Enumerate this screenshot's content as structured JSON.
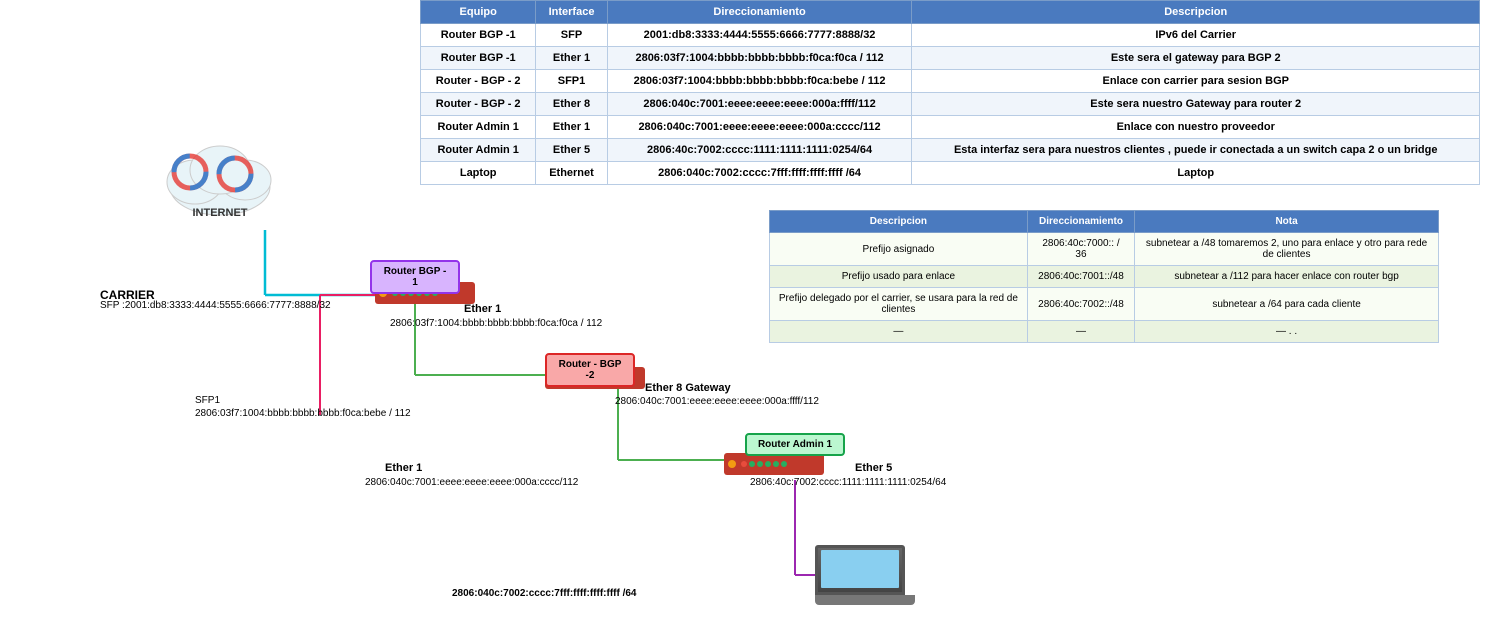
{
  "table1": {
    "headers": [
      "Equipo",
      "Interface",
      "Direccionamiento",
      "Descripcion"
    ],
    "rows": [
      {
        "equipo": "Router BGP -1",
        "interface": "SFP",
        "direccionamiento": "2001:db8:3333:4444:5555:6666:7777:8888/32",
        "descripcion": "IPv6 del Carrier"
      },
      {
        "equipo": "Router BGP -1",
        "interface": "Ether 1",
        "direccionamiento": "2806:03f7:1004:bbbb:bbbb:bbbb:f0ca:f0ca / 112",
        "descripcion": "Este sera el gateway para BGP 2"
      },
      {
        "equipo": "Router - BGP - 2",
        "interface": "SFP1",
        "direccionamiento": "2806:03f7:1004:bbbb:bbbb:bbbb:f0ca:bebe / 112",
        "descripcion": "Enlace con carrier para sesion BGP"
      },
      {
        "equipo": "Router - BGP - 2",
        "interface": "Ether 8",
        "direccionamiento": "2806:040c:7001:eeee:eeee:eeee:000a:ffff/112",
        "descripcion": "Este sera nuestro Gateway para router 2"
      },
      {
        "equipo": "Router Admin 1",
        "interface": "Ether 1",
        "direccionamiento": "2806:040c:7001:eeee:eeee:eeee:000a:cccc/112",
        "descripcion": "Enlace con nuestro proveedor"
      },
      {
        "equipo": "Router Admin 1",
        "interface": "Ether 5",
        "direccionamiento": "2806:40c:7002:cccc:1111:1111:1111:0254/64",
        "descripcion": "Esta interfaz sera para nuestros clientes , puede ir conectada a un switch capa 2 o un bridge"
      },
      {
        "equipo": "Laptop",
        "interface": "Ethernet",
        "direccionamiento": "2806:040c:7002:cccc:7fff:ffff:ffff:ffff /64",
        "descripcion": "Laptop"
      }
    ]
  },
  "table2": {
    "headers": [
      "Descripcion",
      "Direccionamiento",
      "Nota"
    ],
    "rows": [
      {
        "descripcion": "Prefijo asignado",
        "direccionamiento": "2806:40c:7000:: / 36",
        "nota": "subnetear a /48  tomaremos 2, uno para enlace y otro para rede de clientes"
      },
      {
        "descripcion": "Prefijo usado para enlace",
        "direccionamiento": "2806:40c:7001::/48",
        "nota": "subnetear a /112 para hacer enlace con router bgp"
      },
      {
        "descripcion": "Prefijo delegado por el carrier, se usara para la red de clientes",
        "direccionamiento": "2806:40c:7002::/48",
        "nota": "subnetear a /64 para cada cliente"
      },
      {
        "descripcion": "—",
        "direccionamiento": "—",
        "nota": "— . ."
      }
    ]
  },
  "diagram": {
    "internet_label": "INTERNET",
    "carrier_label": "CARRIER",
    "sfp_label": "SFP :2001:db8:3333:4444:5555:6666:7777:8888/32",
    "router_bgp1_label": "Router BGP -\n1",
    "router_bgp2_label": "Router - BGP -2",
    "router_admin1_label": "Router Admin 1",
    "ether1_bgp1_label": "Ether 1",
    "ether1_bgp1_addr": "2806:03f7:1004:bbbb:bbbb:bbbb:f0ca:f0ca / 112",
    "sfp1_label": "SFP1",
    "sfp1_addr": "2806:03f7:1004:bbbb:bbbb:bbbb:f0ca:bebe / 112",
    "ether8_label": "Ether 8 Gateway",
    "ether8_addr": "2806:040c:7001:eeee:eeee:eeee:000a:ffff/112",
    "ether1_bgp2_label": "Ether 1",
    "ether1_bgp2_addr": "2806:040c:7001:eeee:eeee:eeee:000a:cccc/112",
    "ether5_label": "Ether 5",
    "ether5_addr": "2806:40c:7002:cccc:1111:1111:1111:0254/64",
    "laptop_addr": "2806:040c:7002:cccc:7fff:ffff:ffff:ffff /64"
  }
}
